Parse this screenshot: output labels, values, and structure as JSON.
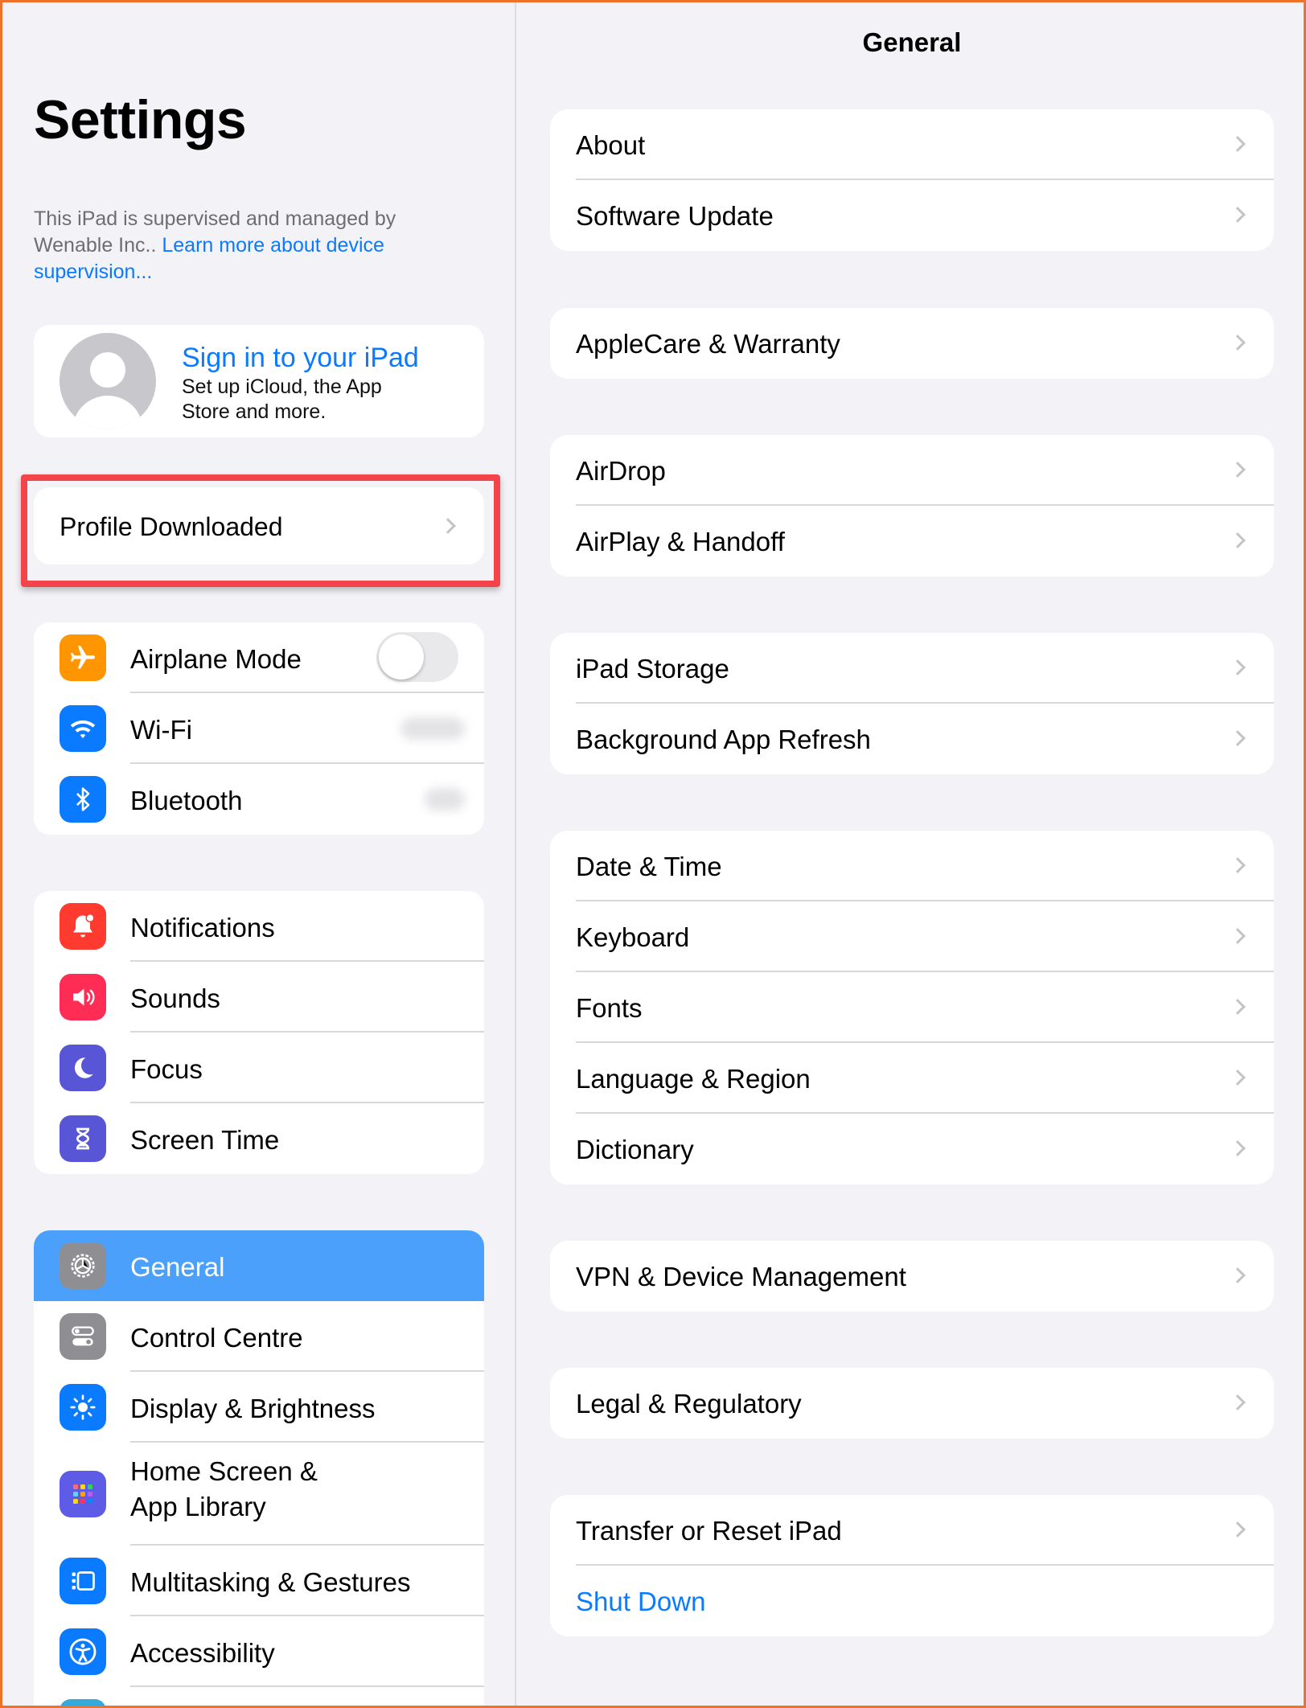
{
  "sidebar": {
    "title": "Settings",
    "supervision_text": "This iPad is supervised and managed by Wenable Inc.. ",
    "supervision_link": "Learn more about device supervision...",
    "account": {
      "title": "Sign in to your iPad",
      "subtitle": "Set up iCloud, the App Store and more."
    },
    "profile_label": "Profile Downloaded",
    "group1": [
      {
        "label": "Airplane Mode",
        "icon": "airplane-icon",
        "color": "#ff9500"
      },
      {
        "label": "Wi-Fi",
        "icon": "wifi-icon",
        "color": "#0a7aff"
      },
      {
        "label": "Bluetooth",
        "icon": "bluetooth-icon",
        "color": "#0a7aff"
      }
    ],
    "group2": [
      {
        "label": "Notifications",
        "icon": "notifications-icon",
        "color": "#ff3b30"
      },
      {
        "label": "Sounds",
        "icon": "sounds-icon",
        "color": "#ff2d55"
      },
      {
        "label": "Focus",
        "icon": "moon-icon",
        "color": "#5856d6"
      },
      {
        "label": "Screen Time",
        "icon": "hourglass-icon",
        "color": "#5856d6"
      }
    ],
    "group3": [
      {
        "label": "General",
        "icon": "gear-icon",
        "color": "#8e8e93",
        "selected": true
      },
      {
        "label": "Control Centre",
        "icon": "control-centre-icon",
        "color": "#8e8e93"
      },
      {
        "label": "Display & Brightness",
        "icon": "brightness-icon",
        "color": "#0a7aff"
      },
      {
        "label_line1": "Home Screen &",
        "label_line2": "App Library",
        "icon": "home-screen-icon",
        "color": "#5e5ce6"
      },
      {
        "label": "Multitasking & Gestures",
        "icon": "multitasking-icon",
        "color": "#0a7aff"
      },
      {
        "label": "Accessibility",
        "icon": "accessibility-icon",
        "color": "#0a7aff"
      }
    ]
  },
  "detail": {
    "title": "General",
    "groups": [
      [
        "About",
        "Software Update"
      ],
      [
        "AppleCare & Warranty"
      ],
      [
        "AirDrop",
        "AirPlay & Handoff"
      ],
      [
        "iPad Storage",
        "Background App Refresh"
      ],
      [
        "Date & Time",
        "Keyboard",
        "Fonts",
        "Language & Region",
        "Dictionary"
      ],
      [
        "VPN & Device Management"
      ],
      [
        "Legal & Regulatory"
      ],
      [
        "Transfer or Reset iPad"
      ]
    ],
    "shut_down": "Shut Down"
  },
  "colors": {
    "accent": "#0a7aff",
    "selected_row": "#4aa0fb",
    "highlight_box": "#f2444a",
    "frame": "#f0722a"
  }
}
